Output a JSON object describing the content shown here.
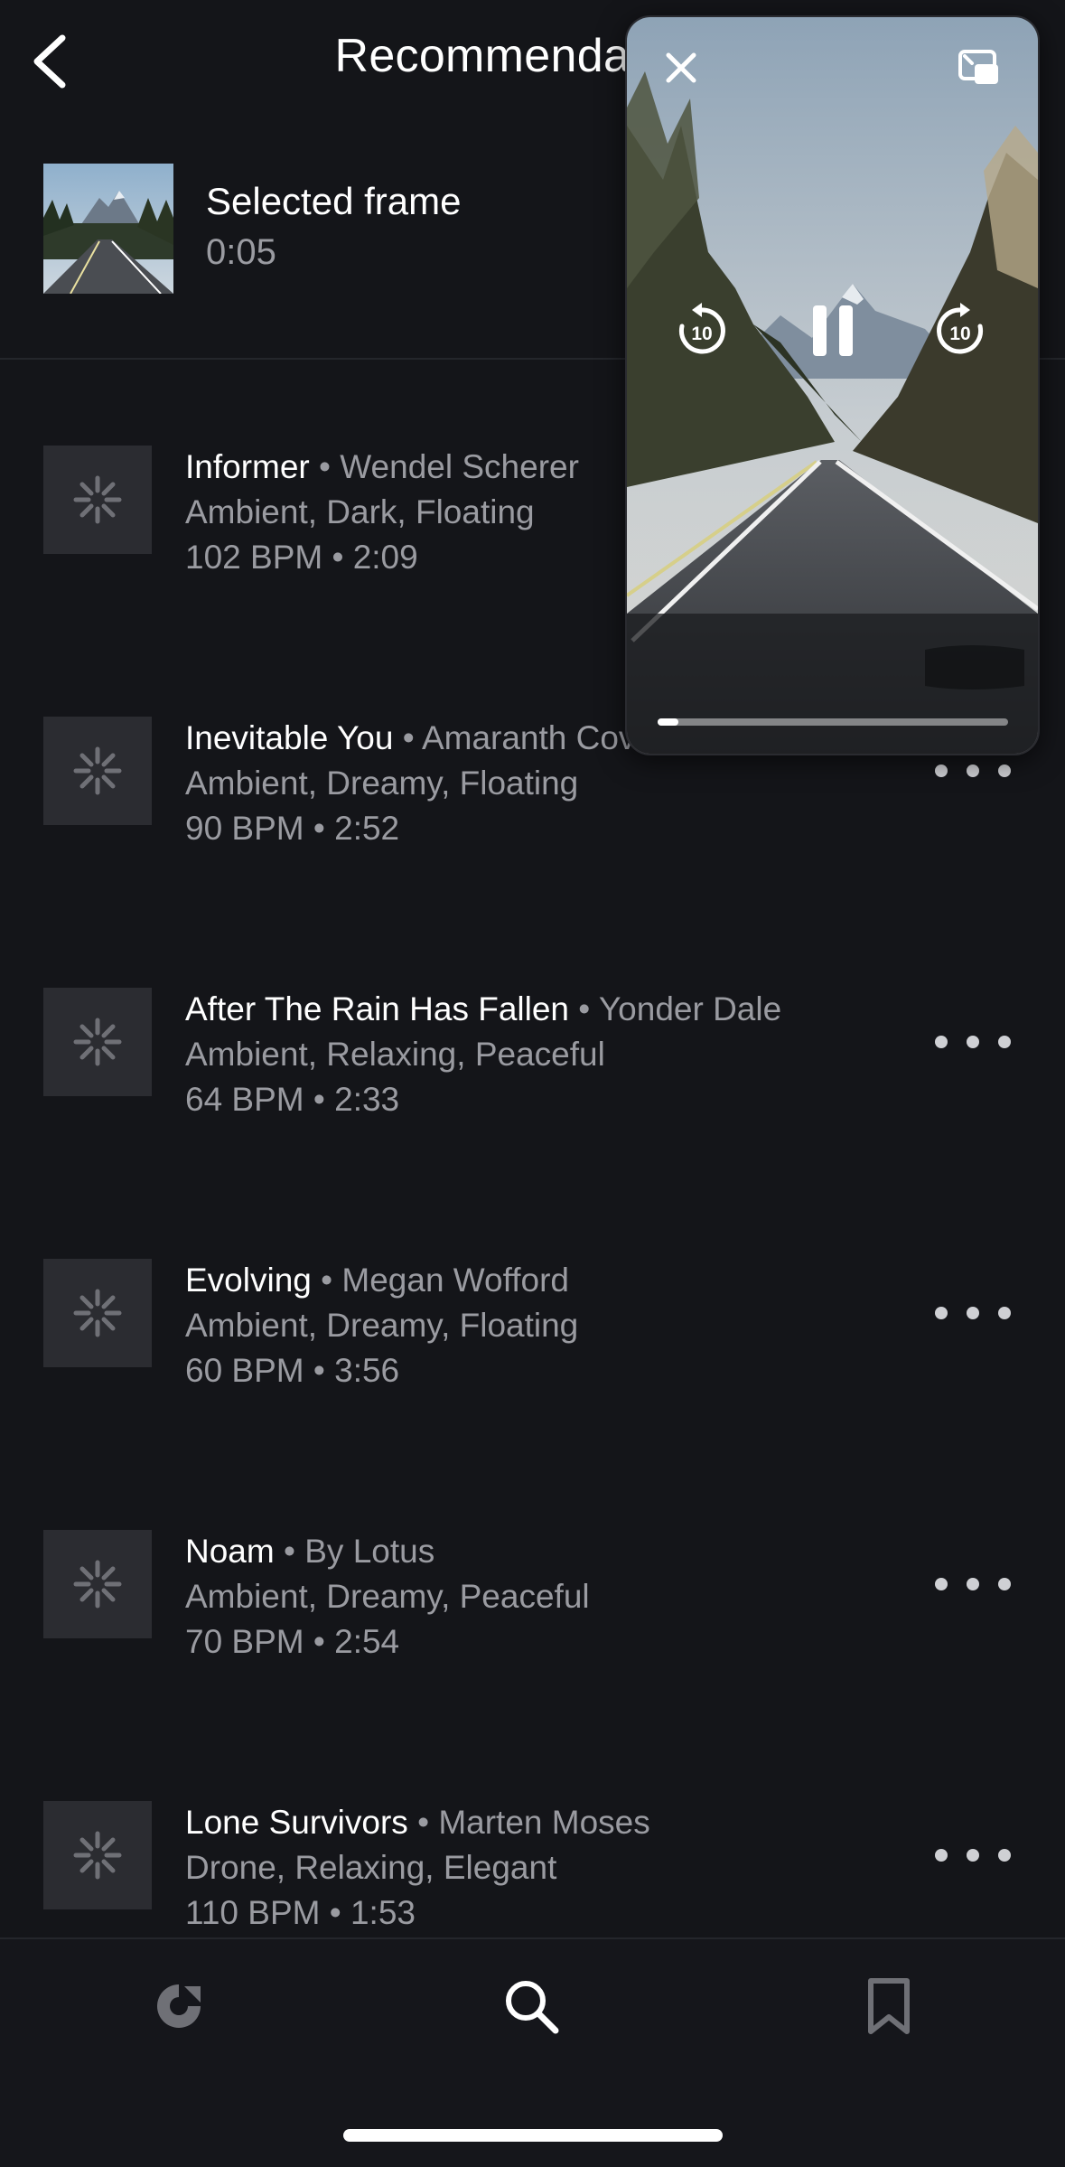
{
  "header": {
    "title": "Recommendations",
    "back_icon": "chevron-left-icon"
  },
  "selected_frame": {
    "label": "Selected frame",
    "time": "0:05"
  },
  "tracks": [
    {
      "name": "Informer",
      "artist": "Wendel Scherer",
      "tags": "Ambient, Dark, Floating",
      "meta": "102 BPM • 2:09"
    },
    {
      "name": "Inevitable You",
      "artist": "Amaranth Cove",
      "tags": "Ambient, Dreamy, Floating",
      "meta": "90 BPM • 2:52"
    },
    {
      "name": "After The Rain Has Fallen",
      "artist": "Yonder Dale",
      "tags": "Ambient, Relaxing, Peaceful",
      "meta": "64 BPM • 2:33"
    },
    {
      "name": "Evolving",
      "artist": "Megan Wofford",
      "tags": "Ambient, Dreamy, Floating",
      "meta": "60 BPM • 3:56"
    },
    {
      "name": "Noam",
      "artist": "By Lotus",
      "tags": "Ambient, Dreamy, Peaceful",
      "meta": "70 BPM • 2:54"
    },
    {
      "name": "Lone Survivors",
      "artist": "Marten Moses",
      "tags": "Drone, Relaxing, Elegant",
      "meta": "110 BPM • 1:53"
    }
  ],
  "separator": "•",
  "pip": {
    "skip_back_label": "10",
    "skip_forward_label": "10",
    "progress": 0.06,
    "icons": [
      "close-icon",
      "restore-window-icon",
      "rewind-10-icon",
      "pause-icon",
      "forward-10-icon"
    ]
  },
  "tabbar": {
    "icons": [
      "discover-icon",
      "search-icon",
      "bookmark-icon"
    ]
  },
  "colors": {
    "background": "#141519",
    "secondary_text": "#9a9ba1",
    "primary_text": "#ffffff"
  }
}
